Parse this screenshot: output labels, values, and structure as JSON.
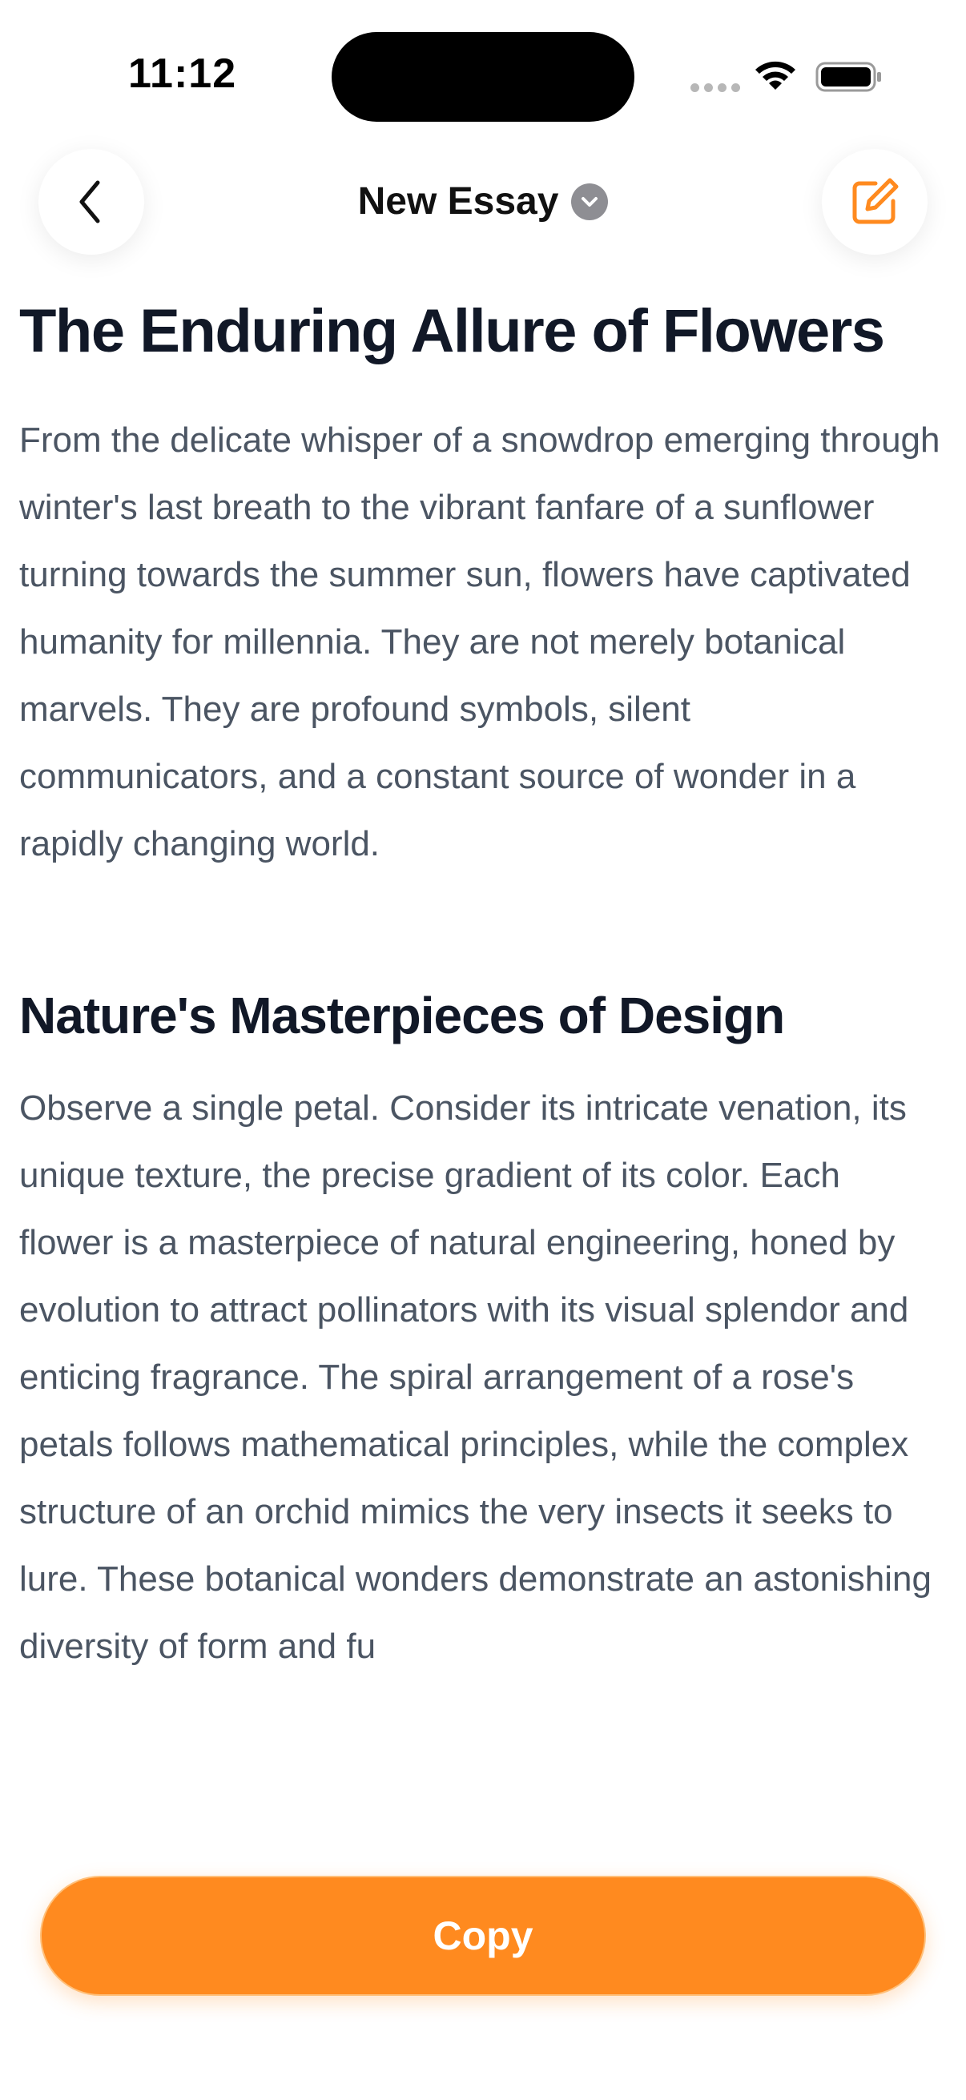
{
  "status_bar": {
    "time": "11:12"
  },
  "nav": {
    "title": "New Essay",
    "back_icon": "chevron-left-icon",
    "compose_icon": "square-pencil-icon",
    "dropdown_icon": "chevron-down-icon"
  },
  "essay": {
    "title": "The Enduring Allure of Flowers",
    "intro": "From the delicate whisper of a snowdrop emerging through winter's last breath to the vibrant fanfare of a sunflower turning towards the summer sun, flowers have captivated humanity for millennia. They are not merely botanical marvels. They are profound symbols, silent communicators, and a constant source of wonder in a rapidly changing world.",
    "section_heading": "Nature's Masterpieces of Design",
    "section_body": "Observe a single petal. Consider its intricate venation, its unique texture, the precise gradient of its color. Each flower is a masterpiece of natural engineering, honed by evolution to attract pollinators with its visual splendor and enticing fragrance. The spiral arrangement of a rose's petals follows mathematical principles, while the complex structure of an orchid mimics the very insects it seeks to lure. These botanical wonders demonstrate an astonishing diversity of form and fu"
  },
  "actions": {
    "copy_label": "Copy"
  },
  "colors": {
    "accent": "#ff8a1f",
    "title_text": "#111827",
    "body_text": "#4b5563"
  }
}
